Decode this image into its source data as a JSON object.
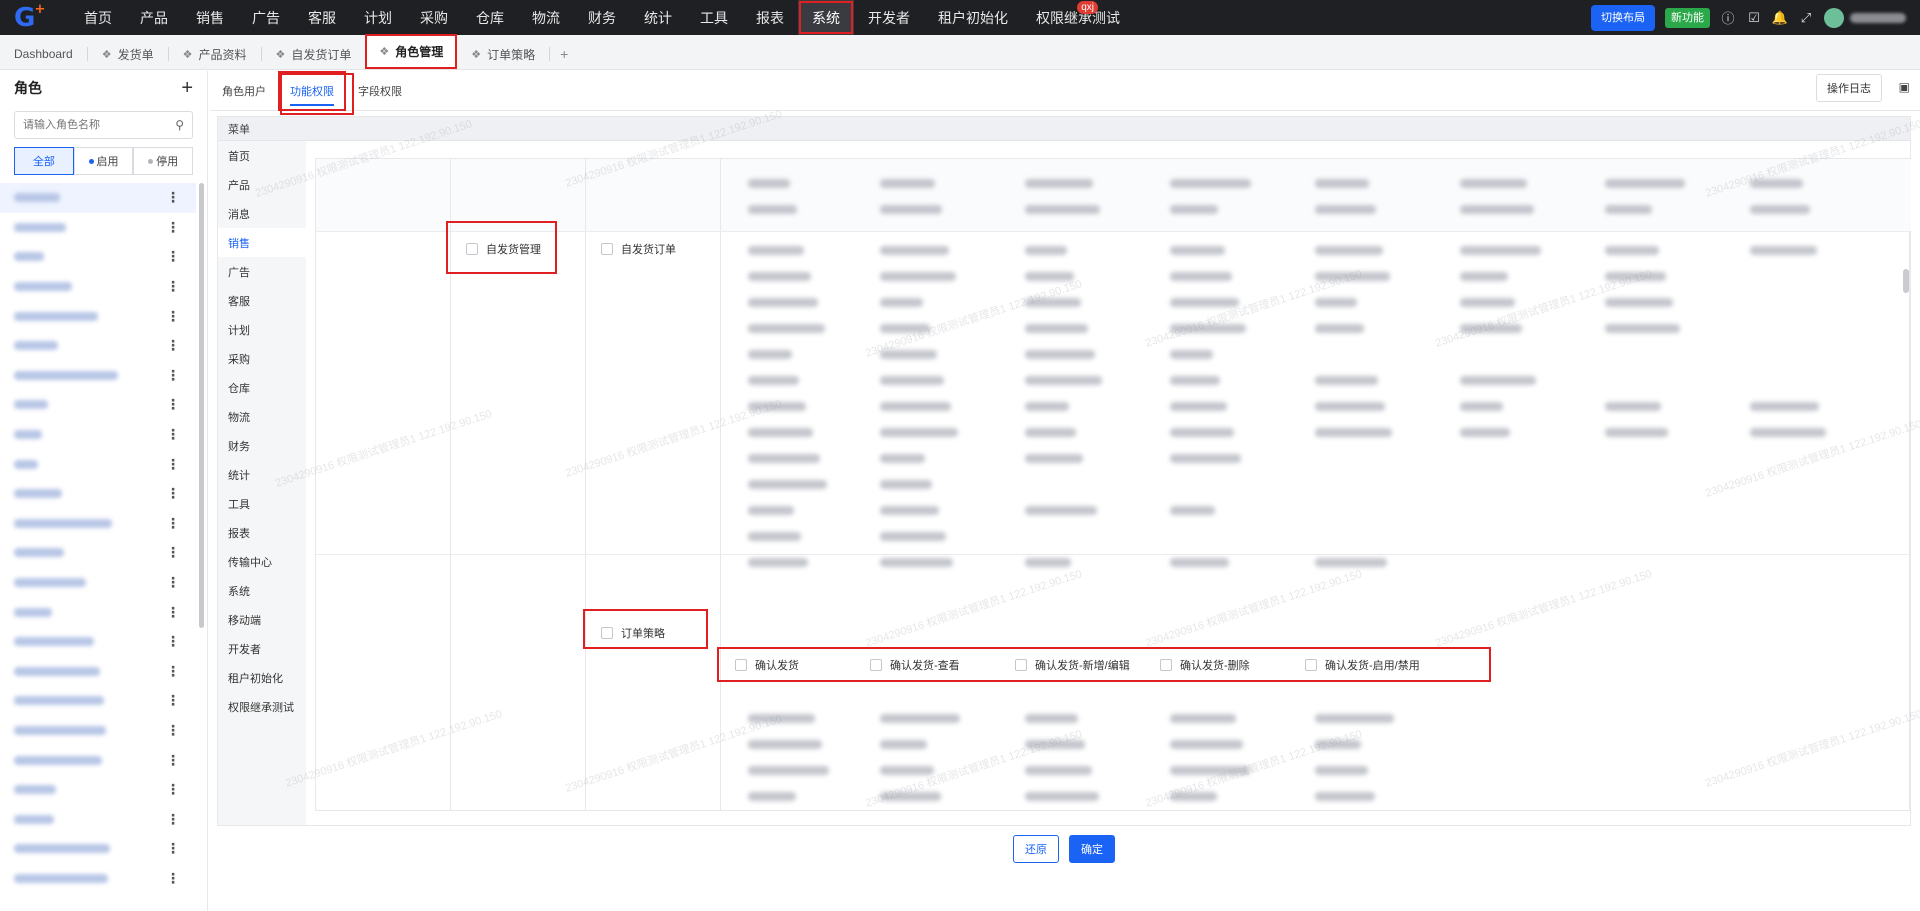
{
  "topbar": {
    "nav": [
      "首页",
      "产品",
      "销售",
      "广告",
      "客服",
      "计划",
      "采购",
      "仓库",
      "物流",
      "财务",
      "统计",
      "工具",
      "报表",
      "系统",
      "开发者",
      "租户初始化",
      "权限继承测试"
    ],
    "active_nav": "系统",
    "badge": "qxj",
    "switch_layout": "切换布局",
    "new_feature": "新功能"
  },
  "tabs": {
    "dashboard": "Dashboard",
    "items": [
      "发货单",
      "产品资料",
      "自发货订单",
      "角色管理",
      "订单策略"
    ],
    "active": "角色管理",
    "add": "+"
  },
  "role_panel": {
    "title": "角色",
    "add": "+",
    "search_placeholder": "请输入角色名称",
    "filters": [
      "全部",
      "启用",
      "停用"
    ],
    "active_filter": "全部",
    "colors": {
      "enabled_dot": "#1b63f5",
      "disabled_dot": "#b0b4bb"
    }
  },
  "subtabs": [
    "角色用户",
    "功能权限",
    "字段权限"
  ],
  "active_subtab": "功能权限",
  "log_button": "操作日志",
  "menu": {
    "header": "菜单",
    "items": [
      "首页",
      "产品",
      "消息",
      "销售",
      "广告",
      "客服",
      "计划",
      "采购",
      "仓库",
      "物流",
      "财务",
      "统计",
      "工具",
      "报表",
      "传输中心",
      "系统",
      "移动端",
      "开发者",
      "租户初始化",
      "权限继承测试"
    ],
    "active": "销售"
  },
  "permissions": {
    "module": "自发货管理",
    "page": "自发货订单",
    "sub_page": "订单策略",
    "actions": [
      "确认发货",
      "确认发货-查看",
      "确认发货-新增/编辑",
      "确认发货-删除",
      "确认发货-启用/禁用"
    ]
  },
  "footer": {
    "reset": "还原",
    "confirm": "确定"
  },
  "colors": {
    "accent": "#1b63f5",
    "highlight": "#e02020",
    "topbar": "#1f2024",
    "new_badge": "#2ba84a"
  }
}
